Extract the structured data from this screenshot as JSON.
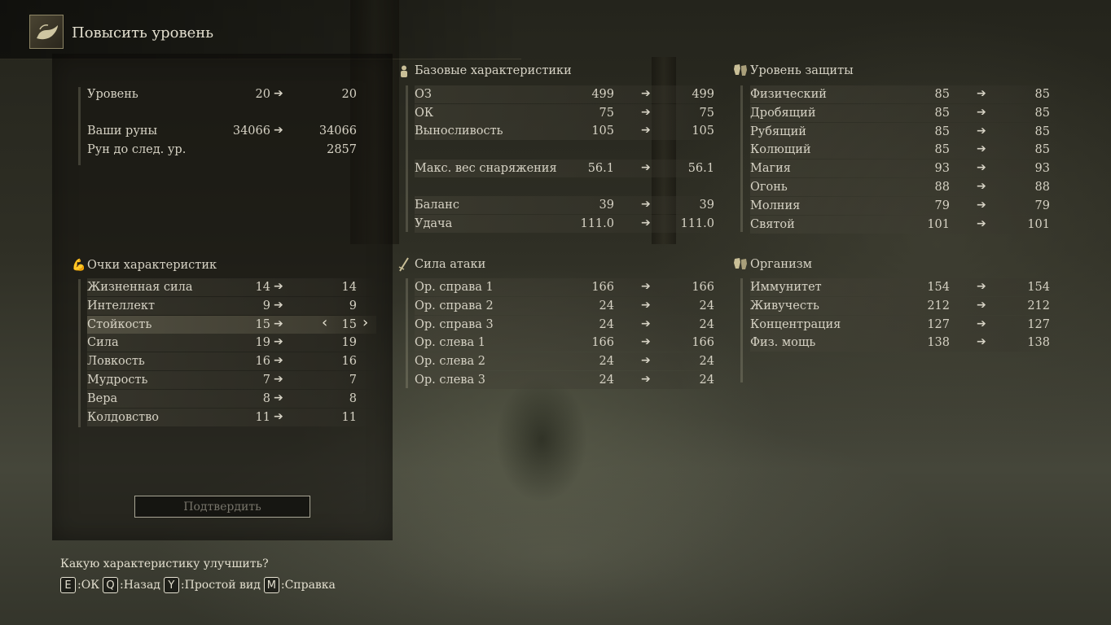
{
  "header": {
    "title": "Повысить уровень",
    "icon": "grace-hand-icon"
  },
  "level_info": [
    {
      "label": "Уровень",
      "from": "20",
      "to": "20",
      "arrow": "➔"
    },
    {
      "label": "Ваши руны",
      "from": "34066",
      "to": "34066",
      "arrow": "➔"
    },
    {
      "label": "Рун до след. ур.",
      "from": "",
      "to": "2857",
      "arrow": ""
    }
  ],
  "attributes": {
    "title": "Очки характеристик",
    "icon": "flexed-arm-icon",
    "rows": [
      {
        "label": "Жизненная сила",
        "from": "14",
        "to": "14"
      },
      {
        "label": "Интеллект",
        "from": "9",
        "to": "9"
      },
      {
        "label": "Стойкость",
        "from": "15",
        "to": "15"
      },
      {
        "label": "Сила",
        "from": "19",
        "to": "19"
      },
      {
        "label": "Ловкость",
        "from": "16",
        "to": "16"
      },
      {
        "label": "Мудрость",
        "from": "7",
        "to": "7"
      },
      {
        "label": "Вера",
        "from": "8",
        "to": "8"
      },
      {
        "label": "Колдовство",
        "from": "11",
        "to": "11"
      }
    ],
    "selected_index": 2,
    "left_arrow": "‹",
    "right_arrow": "›"
  },
  "confirm_button": "Подтвердить",
  "base_stats": {
    "title": "Базовые характеристики",
    "icon": "person-icon",
    "rows": [
      {
        "label": "ОЗ",
        "from": "499",
        "to": "499"
      },
      {
        "label": "ОК",
        "from": "75",
        "to": "75"
      },
      {
        "label": "Выносливость",
        "from": "105",
        "to": "105"
      },
      {
        "label": "Макс. вес снаряжения",
        "from": "56.1",
        "to": "56.1"
      },
      {
        "label": "Баланс",
        "from": "39",
        "to": "39"
      },
      {
        "label": "Удача",
        "from": "111.0",
        "to": "111.0"
      }
    ]
  },
  "attack_power": {
    "title": "Сила атаки",
    "icon": "sword-icon",
    "rows": [
      {
        "label": "Ор. справа 1",
        "from": "166",
        "to": "166"
      },
      {
        "label": "Ор. справа 2",
        "from": "24",
        "to": "24"
      },
      {
        "label": "Ор. справа 3",
        "from": "24",
        "to": "24"
      },
      {
        "label": "Ор. слева 1",
        "from": "166",
        "to": "166"
      },
      {
        "label": "Ор. слева 2",
        "from": "24",
        "to": "24"
      },
      {
        "label": "Ор. слева 3",
        "from": "24",
        "to": "24"
      }
    ]
  },
  "defense": {
    "title": "Уровень защиты",
    "icon": "armor-icon",
    "rows": [
      {
        "label": "Физический",
        "from": "85",
        "to": "85"
      },
      {
        "label": "Дробящий",
        "from": "85",
        "to": "85"
      },
      {
        "label": "Рубящий",
        "from": "85",
        "to": "85"
      },
      {
        "label": "Колющий",
        "from": "85",
        "to": "85"
      },
      {
        "label": "Магия",
        "from": "93",
        "to": "93"
      },
      {
        "label": "Огонь",
        "from": "88",
        "to": "88"
      },
      {
        "label": "Молния",
        "from": "79",
        "to": "79"
      },
      {
        "label": "Святой",
        "from": "101",
        "to": "101"
      }
    ]
  },
  "resistance": {
    "title": "Организм",
    "icon": "armor-icon",
    "rows": [
      {
        "label": "Иммунитет",
        "from": "154",
        "to": "154"
      },
      {
        "label": "Живучесть",
        "from": "212",
        "to": "212"
      },
      {
        "label": "Концентрация",
        "from": "127",
        "to": "127"
      },
      {
        "label": "Физ. мощь",
        "from": "138",
        "to": "138"
      }
    ]
  },
  "arrow_glyph": "➔",
  "footer": {
    "prompt": "Какую характеристику улучшить?",
    "keys": [
      {
        "key": "E",
        "label": ":ОК"
      },
      {
        "key": "Q",
        "label": ":Назад"
      },
      {
        "key": "Y",
        "label": ":Простой вид"
      },
      {
        "key": "M",
        "label": ":Справка"
      }
    ]
  }
}
